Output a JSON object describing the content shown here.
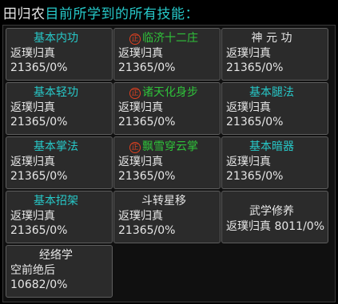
{
  "header": {
    "character_name": "田归农",
    "subtitle": "目前所学到的所有技能："
  },
  "colors": {
    "accent_cyan": "#27c9c9",
    "sect_green": "#2fc23a",
    "sect_badge_red": "#e04020"
  },
  "skills": [
    {
      "name": "基本内功",
      "level": "返璞归真",
      "progress": "21365/0%",
      "name_color": "cyan",
      "sect": false
    },
    {
      "name": "临济十二庄",
      "level": "返璞归真",
      "progress": "21365/0%",
      "name_color": "green",
      "sect": true
    },
    {
      "name": "神 元 功",
      "level": "返璞归真",
      "progress": "21365/0%",
      "name_color": "white",
      "sect": false
    },
    {
      "name": "基本轻功",
      "level": "返璞归真",
      "progress": "21365/0%",
      "name_color": "cyan",
      "sect": false
    },
    {
      "name": "诸天化身步",
      "level": "返璞归真",
      "progress": "21365/0%",
      "name_color": "green",
      "sect": true
    },
    {
      "name": "基本腿法",
      "level": "返璞归真",
      "progress": "21365/0%",
      "name_color": "cyan",
      "sect": false
    },
    {
      "name": "基本掌法",
      "level": "返璞归真",
      "progress": "21365/0%",
      "name_color": "cyan",
      "sect": false
    },
    {
      "name": "飘雪穿云掌",
      "level": "返璞归真",
      "progress": "21365/0%",
      "name_color": "green",
      "sect": true
    },
    {
      "name": "基本暗器",
      "level": "返璞归真",
      "progress": "21365/0%",
      "name_color": "cyan",
      "sect": false
    },
    {
      "name": "基本招架",
      "level": "返璞归真",
      "progress": "21365/0%",
      "name_color": "cyan",
      "sect": false
    },
    {
      "name": "斗转星移",
      "level": "返璞归真",
      "progress": "21365/0%",
      "name_color": "white",
      "sect": false
    },
    {
      "name": "武学修养",
      "level": "返璞归真 8011/0%",
      "progress": "",
      "name_color": "white",
      "sect": false
    },
    {
      "name": "经络学",
      "level": "空前绝后",
      "progress": "10682/0%",
      "name_color": "white",
      "sect": false
    }
  ],
  "sect_badge_glyph": "正"
}
